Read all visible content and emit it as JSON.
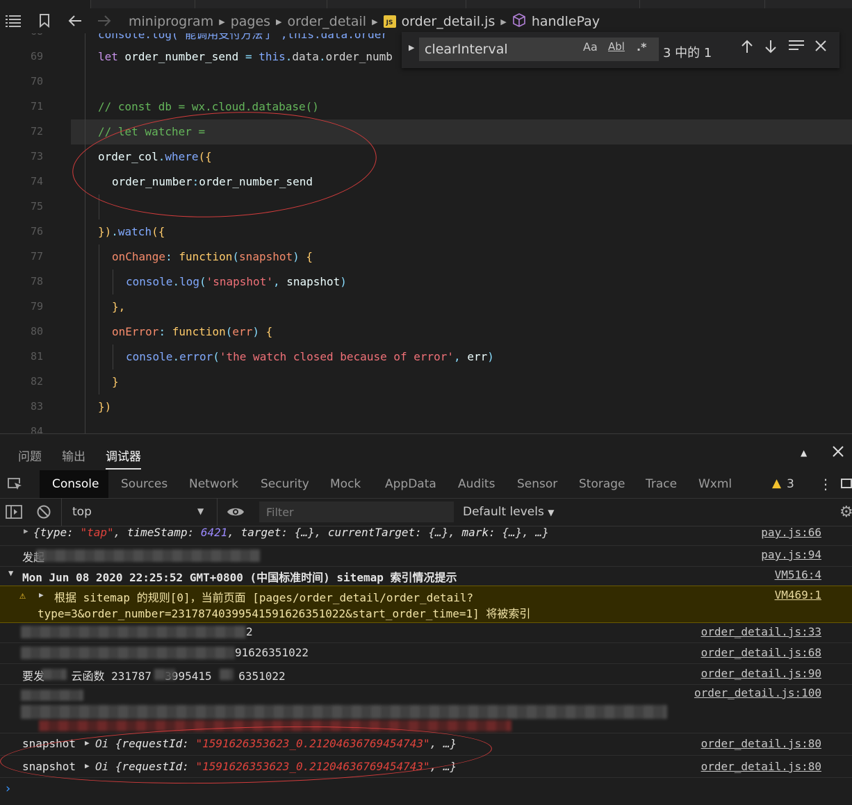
{
  "breadcrumb": {
    "folder1": "miniprogram",
    "folder2": "pages",
    "folder3": "order_detail",
    "file": "order_detail.js",
    "file_badge": "JS",
    "symbol": "handlePay"
  },
  "editor": {
    "lines": [
      {
        "num": "68",
        "text": "console.log('能调用支付方法了',this.data.order"
      },
      {
        "num": "69",
        "text": "let order_number_send = this.data.order_numb"
      },
      {
        "num": "70",
        "text": ""
      },
      {
        "num": "71",
        "text": "// const db = wx.cloud.database()"
      },
      {
        "num": "72",
        "text": "// let watcher ="
      },
      {
        "num": "73",
        "text": "order_col.where({"
      },
      {
        "num": "74",
        "text": "order_number:order_number_send"
      },
      {
        "num": "75",
        "text": ""
      },
      {
        "num": "76",
        "text": "}).watch({"
      },
      {
        "num": "77",
        "text": "onChange: function(snapshot) {"
      },
      {
        "num": "78",
        "text": "console.log('snapshot', snapshot)"
      },
      {
        "num": "79",
        "text": "},"
      },
      {
        "num": "80",
        "text": "onError: function(err) {"
      },
      {
        "num": "81",
        "text": "console.error('the watch closed because of error', err)"
      },
      {
        "num": "82",
        "text": "}"
      },
      {
        "num": "83",
        "text": "})"
      },
      {
        "num": "84",
        "text": ""
      }
    ]
  },
  "find": {
    "value": "clearInterval",
    "match_case": "Aa",
    "whole_word": "Abl",
    "regex": ".*",
    "count": "3 中的 1"
  },
  "panel": {
    "tabs": [
      "问题",
      "输出",
      "调试器"
    ],
    "devtools_tabs": [
      "Console",
      "Sources",
      "Network",
      "Security",
      "Mock",
      "AppData",
      "Audits",
      "Sensor",
      "Storage",
      "Trace",
      "Wxml"
    ],
    "warning_count": "3",
    "context": "top",
    "filter_placeholder": "Filter",
    "levels": "Default levels"
  },
  "console": {
    "row1": {
      "text": "{type: \"tap\", timeStamp: 6421, target: {…}, currentTarget: {…}, mark: {…}, …}",
      "src": "pay.js:66"
    },
    "row2": {
      "text": "发起",
      "src": "pay.js:94"
    },
    "row3": {
      "text": "Mon Jun 08 2020 22:25:52 GMT+0800 (中国标准时间) sitemap 索引情况提示",
      "src": "VM516:4"
    },
    "row4": {
      "line1": "根据 sitemap 的规则[0]，当前页面 [pages/order_detail/order_detail?",
      "line2": "type=3&order_number=23178740399541591626351022&start_order_time=1] 将被索引",
      "src": "VM469:1"
    },
    "row5": {
      "text": "2",
      "src": "order_detail.js:33"
    },
    "row6": {
      "text": "91626351022",
      "src": "order_detail.js:68"
    },
    "row7": {
      "text": "要发    云函数 231787  3995415    6351022",
      "src": "order_detail.js:90"
    },
    "row8": {
      "src": "order_detail.js:100"
    },
    "row9": {
      "label": "snapshot",
      "obj": "Oi",
      "key": "requestId",
      "value": "\"1591626353623_0.21204636769454743\"",
      "src": "order_detail.js:80"
    },
    "row10": {
      "label": "snapshot",
      "obj": "Oi",
      "key": "requestId",
      "value": "\"1591626353623_0.21204636769454743\"",
      "src": "order_detail.js:80"
    }
  }
}
